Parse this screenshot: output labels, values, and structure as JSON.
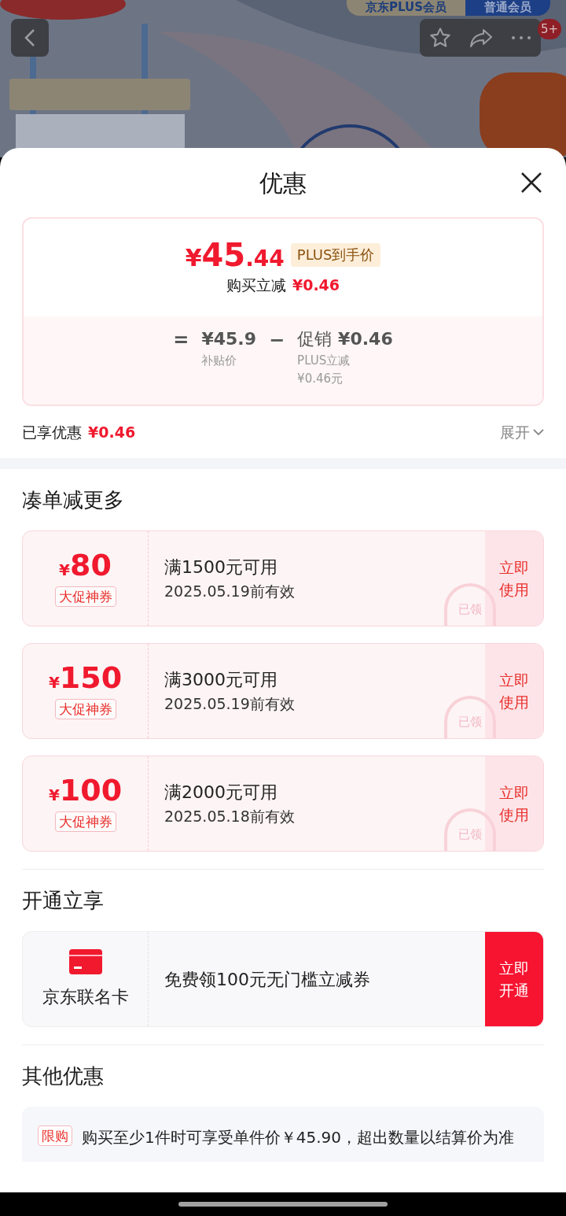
{
  "background": {
    "member_tabs": [
      {
        "label": "京东PLUS会员",
        "selected": true
      },
      {
        "label": "普通会员",
        "selected": false
      }
    ],
    "badge": "5+"
  },
  "sheet": {
    "title": "优惠",
    "price_card": {
      "currency": "¥",
      "price_int": "45",
      "price_dec": ".44",
      "price_tag": "PLUS到手价",
      "reduce_label": "购买立减",
      "reduce_value": "¥0.46",
      "formula": {
        "equals": "=",
        "base_value": "¥45.9",
        "base_label": "补贴价",
        "minus": "−",
        "promo_label": "促销",
        "promo_value": "¥0.46",
        "promo_detail_1": "PLUS立减",
        "promo_detail_2": "¥0.46元"
      }
    },
    "enjoyed": {
      "label": "已享优惠",
      "value": "¥0.46",
      "expand": "展开"
    },
    "sections": [
      {
        "title": "凑单减更多",
        "kind": "coupons",
        "items": [
          {
            "currency": "¥",
            "amount": "80",
            "tag": "大促神券",
            "condition": "满1500元可用",
            "expiry": "2025.05.19前有效",
            "action": "立即使用",
            "stamp": "已领",
            "claimed": true
          },
          {
            "currency": "¥",
            "amount": "150",
            "tag": "大促神券",
            "condition": "满3000元可用",
            "expiry": "2025.05.19前有效",
            "action": "立即使用",
            "stamp": "已领",
            "claimed": true
          },
          {
            "currency": "¥",
            "amount": "100",
            "tag": "大促神券",
            "condition": "满2000元可用",
            "expiry": "2025.05.18前有效",
            "action": "立即使用",
            "stamp": "已领",
            "claimed": true
          }
        ]
      },
      {
        "title": "开通立享",
        "kind": "card",
        "items": [
          {
            "name": "京东联名卡",
            "description": "免费领100元无门槛立减券",
            "action": "立即开通"
          }
        ]
      },
      {
        "title": "其他优惠",
        "kind": "notes",
        "items": [
          {
            "tag": "限购",
            "text": "购买至少1件时可享受单件价￥45.90，超出数量以结算价为准"
          }
        ]
      }
    ]
  }
}
